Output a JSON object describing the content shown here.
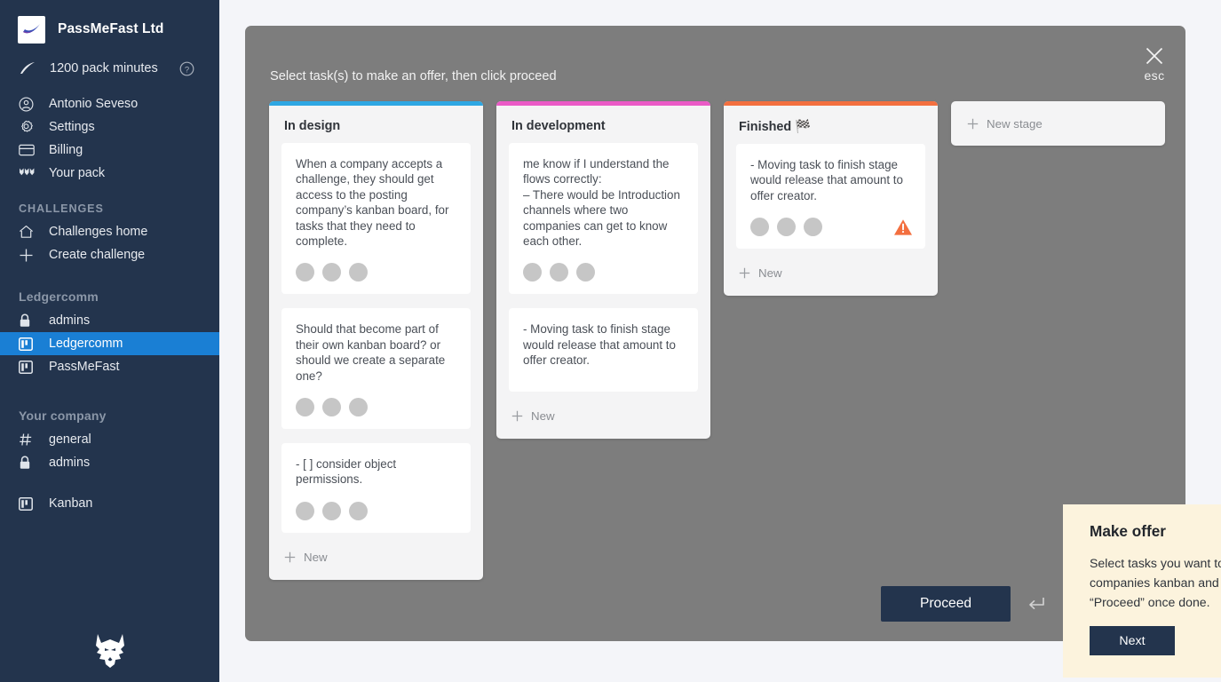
{
  "sidebar": {
    "brand": {
      "name": "PassMeFast Ltd",
      "logo_icon": "swoosh-logo-icon"
    },
    "credits": {
      "icon": "feather-icon",
      "text": "1200 pack minutes",
      "help_icon": "question-circle-icon"
    },
    "primary_items": [
      {
        "icon": "user-circle-icon",
        "label": "Antonio Seveso"
      },
      {
        "icon": "gear-icon",
        "label": "Settings"
      },
      {
        "icon": "credit-card-icon",
        "label": "Billing"
      },
      {
        "icon": "pack-wolves-icon",
        "label": "Your pack"
      }
    ],
    "challenges_section": "CHALLENGES",
    "challenges_items": [
      {
        "icon": "home-icon",
        "label": "Challenges home"
      },
      {
        "icon": "plus-icon",
        "label": "Create challenge"
      }
    ],
    "ledgercomm_section": "Ledgercomm",
    "ledgercomm_items": [
      {
        "icon": "lock-icon",
        "label": "admins",
        "active": false
      },
      {
        "icon": "kanban-icon",
        "label": "Ledgercomm",
        "active": true
      },
      {
        "icon": "kanban-icon",
        "label": "PassMeFast",
        "active": false
      }
    ],
    "company_section": "Your company",
    "company_items": [
      {
        "icon": "hash-icon",
        "label": "general"
      },
      {
        "icon": "lock-icon",
        "label": "admins"
      }
    ],
    "kanban_item": {
      "icon": "kanban-icon",
      "label": "Kanban"
    },
    "footer_logo_icon": "wolf-head-logo-icon",
    "active_color": "#1a7fd4",
    "bg_color": "#23344d"
  },
  "modal": {
    "hint": "Select task(s) to make an offer, then click proceed",
    "close_icon": "close-x-icon",
    "esc_label": "esc",
    "proceed_label": "Proceed",
    "enter_key_icon": "enter-return-icon",
    "new_stage_label": "New stage",
    "new_stage_icon": "plus-icon",
    "overlay_color": "#7d7d7d"
  },
  "board": {
    "columns": [
      {
        "title": "In design",
        "accent": "#2ea7e3",
        "new_label": "New",
        "cards": [
          {
            "text": "When a company accepts a challenge, they should get access to the posting company’s kanban board, for tasks that they need to complete.",
            "avatars": 3,
            "warning": false
          },
          {
            "text": "Should that become part of their own kanban board? or should we create a separate one?",
            "avatars": 3,
            "warning": false
          },
          {
            "text": "- [ ]  consider object permissions.",
            "avatars": 3,
            "warning": false
          }
        ]
      },
      {
        "title": "In development",
        "accent": "#ea5ac6",
        "new_label": "New",
        "cards": [
          {
            "text": " me know if I understand the flows correctly:\n– There would be Introduction channels where two companies can get to know each other.",
            "avatars": 3,
            "warning": false
          },
          {
            "text": "- Moving task to finish stage would release that amount to offer creator.",
            "avatars": 0,
            "warning": false
          }
        ]
      },
      {
        "title": "Finished 🏁",
        "accent": "#f36f3f",
        "new_label": "New",
        "cards": [
          {
            "text": "- Moving task to finish stage would release that amount to offer creator.",
            "avatars": 3,
            "warning": true,
            "warning_color": "#f36f3f"
          }
        ]
      }
    ]
  },
  "popup": {
    "title": "Make offer",
    "body": "Select tasks you want to contribute towards from other companies kanban and make an offer. Click on “Proceed” once done.",
    "next_label": "Next",
    "settings_icon": "gear-icon",
    "close_icon": "close-x-icon",
    "bg_color": "#fcf3dd"
  }
}
